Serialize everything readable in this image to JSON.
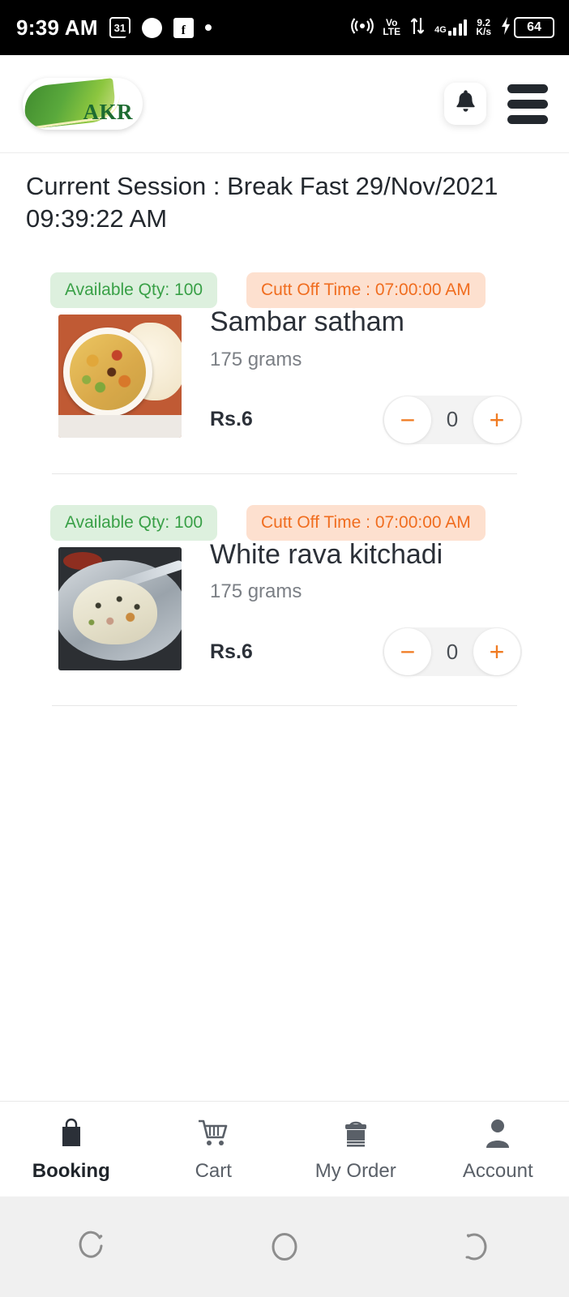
{
  "statusbar": {
    "time": "9:39 AM",
    "calendar_day": "31",
    "flipkart_glyph": "f",
    "volte_top": "Vo",
    "volte_bottom": "LTE",
    "network": "4G",
    "speed_value": "9.2",
    "speed_unit": "K/s",
    "battery": "64",
    "icons": [
      "calendar-icon",
      "circle-icon",
      "flipkart-icon",
      "dot-icon",
      "hotspot-icon",
      "volte-icon",
      "data-transfer-icon",
      "signal-icon",
      "charging-icon",
      "battery-icon"
    ]
  },
  "header": {
    "logo_text": "AKR",
    "bell_icon": "bell-icon",
    "menu_icon": "hamburger-menu-icon"
  },
  "session": {
    "text": "Current Session : Break Fast 29/Nov/2021 09:39:22 AM"
  },
  "products": [
    {
      "qty_badge": "Available Qty: 100",
      "cutoff_badge": "Cutt Off Time : 07:00:00 AM",
      "name": "Sambar satham",
      "weight": "175 grams",
      "price": "Rs.6",
      "quantity": "0",
      "minus_label": "−",
      "plus_label": "+"
    },
    {
      "qty_badge": "Available Qty: 100",
      "cutoff_badge": "Cutt Off Time : 07:00:00 AM",
      "name": "White rava kitchadi",
      "weight": "175 grams",
      "price": "Rs.6",
      "quantity": "0",
      "minus_label": "−",
      "plus_label": "+"
    }
  ],
  "bottom_nav": [
    {
      "label": "Booking",
      "icon": "shopping-bag-icon",
      "active": true
    },
    {
      "label": "Cart",
      "icon": "shopping-cart-icon",
      "active": false
    },
    {
      "label": "My Order",
      "icon": "tiffin-box-icon",
      "active": false
    },
    {
      "label": "Account",
      "icon": "person-icon",
      "active": false
    }
  ],
  "system_nav": {
    "recents": "recents-icon",
    "home": "home-icon",
    "back": "back-icon"
  },
  "colors": {
    "accent_orange": "#f07b22",
    "qty_green_text": "#39a047",
    "qty_green_bg": "#ddf0de",
    "cutoff_orange_text": "#f06d1f",
    "cutoff_orange_bg": "#fde0cf",
    "logo_green": "#1d6b31",
    "text_dark": "#23282e"
  }
}
